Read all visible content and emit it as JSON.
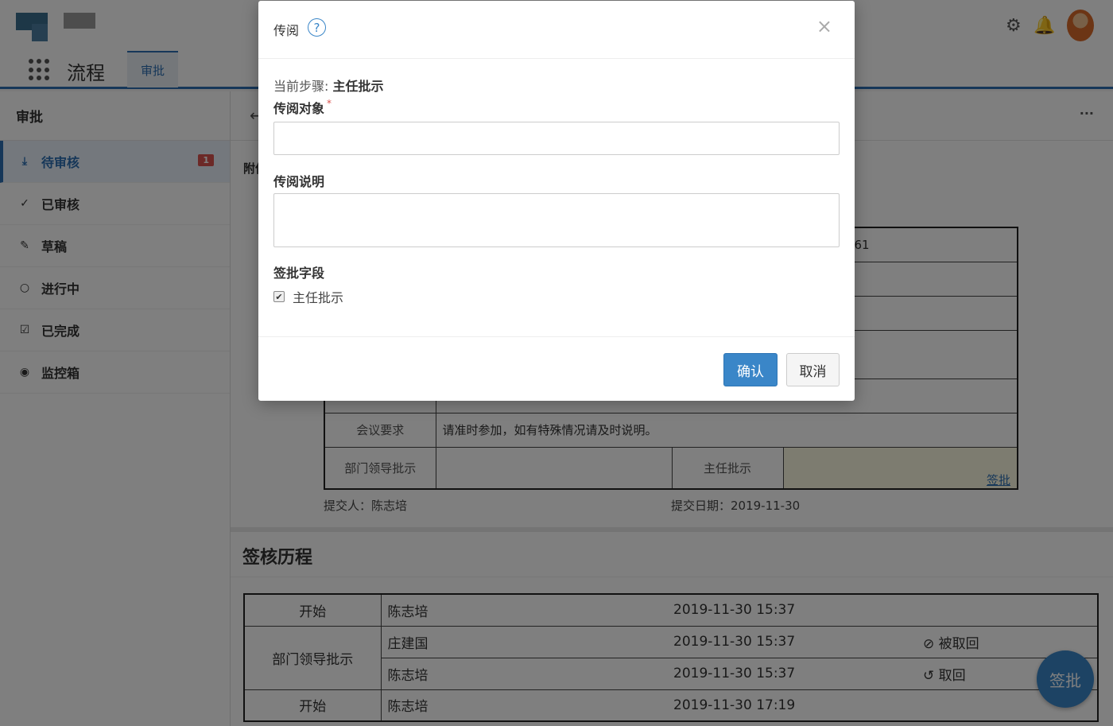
{
  "header": {
    "app_title": "流程",
    "active_tab": "审批"
  },
  "sidebar": {
    "title": "审批",
    "items": [
      {
        "label": "待审核",
        "icon": "inbox-download-icon",
        "badge": "1"
      },
      {
        "label": "已审核",
        "icon": "double-check-icon"
      },
      {
        "label": "草稿",
        "icon": "edit-icon"
      },
      {
        "label": "进行中",
        "icon": "circle-dashed-icon"
      },
      {
        "label": "已完成",
        "icon": "checkbox-icon"
      },
      {
        "label": "监控箱",
        "icon": "eye-icon"
      }
    ]
  },
  "main": {
    "attach_label": "附件",
    "partial_value": "61",
    "meeting_req_label": "会议要求",
    "meeting_req_value": "请准时参加，如有特殊情况请及时说明。",
    "dept_leader_label": "部门领导批示",
    "director_label": "主任批示",
    "sign_link": "签批",
    "submitter": "提交人：陈志培",
    "submit_date": "提交日期：2019-11-30",
    "history_title": "签核历程",
    "history": [
      {
        "step": "开始",
        "person": "陈志培",
        "time": "2019-11-30 15:37",
        "action": ""
      },
      {
        "step": "部门领导批示",
        "person": "庄建国",
        "time": "2019-11-30 15:37",
        "action": "被取回",
        "action_icon": "ban-icon"
      },
      {
        "step": "",
        "person": "陈志培",
        "time": "2019-11-30 15:37",
        "action": "取回",
        "action_icon": "undo-icon"
      },
      {
        "step": "开始",
        "person": "陈志培",
        "time": "2019-11-30 17:19",
        "action": ""
      }
    ],
    "fab_label": "签批"
  },
  "modal": {
    "title": "传阅",
    "current_step_prefix": "当前步骤:",
    "current_step_value": "主任批示",
    "target_label": "传阅对象",
    "target_required_mark": "*",
    "target_value": "",
    "note_label": "传阅说明",
    "note_value": "",
    "sign_field_label": "签批字段",
    "sign_field_option": "主任批示",
    "sign_field_checked": true,
    "confirm_label": "确认",
    "cancel_label": "取消"
  },
  "colors": {
    "accent": "#3a86c8",
    "header_border": "#2d6fb3",
    "badge": "#d9534f",
    "sign_cell_bg": "#fbf8e0"
  }
}
